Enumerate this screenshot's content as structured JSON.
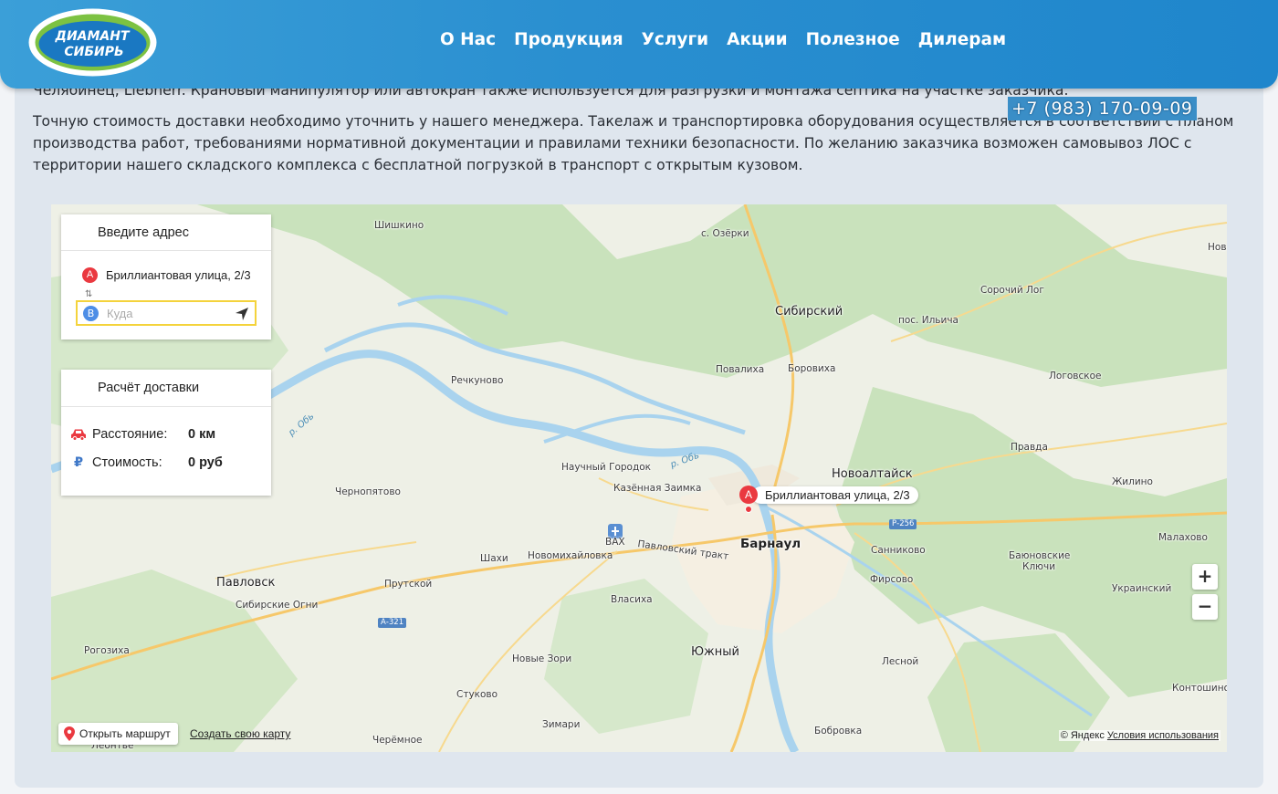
{
  "header": {
    "logo_line1": "ДИАМАНТ",
    "logo_line2": "СИБИРЬ",
    "nav": [
      "О Нас",
      "Продукция",
      "Услуги",
      "Акции",
      "Полезное",
      "Дилерам"
    ],
    "phone": "+7 (983) 170-09-09"
  },
  "content": {
    "para1": "Челябинец, Liebherr. Крановый манипулятор или автокран также используется для разгрузки и монтажа септика на участке заказчика.",
    "para2": "Точную стоимость доставки необходимо уточнить у нашего менеджера. Такелаж и транспортировка оборудования осуществляется в соответствии с планом производства работ, требованиями нормативной документации и правилами техники безопасности. По желанию заказчика возможен самовывоз ЛОС с территории нашего складского комплекса с бесплатной погрузкой в транспорт с открытым кузовом."
  },
  "address_panel": {
    "title": "Введите адрес",
    "point_a_letter": "A",
    "point_a_value": "Бриллиантовая улица, 2/3",
    "swap_icon": "⇅",
    "point_b_letter": "B",
    "point_b_placeholder": "Куда"
  },
  "calc_panel": {
    "title": "Расчёт доставки",
    "distance_label": "Расстояние:",
    "distance_value": "0 км",
    "cost_label": "Стоимость:",
    "cost_value": "0 руб",
    "cost_icon": "₽"
  },
  "map": {
    "placemark_letter": "A",
    "placemark_label": "Бриллиантовая улица, 2/3",
    "zoom_in": "+",
    "zoom_out": "−",
    "open_route": "Открыть маршрут",
    "create_map": "Создать свою карту",
    "copyright": "© Яндекс",
    "terms": "Условия использования",
    "places": {
      "shishkino": "Шишкино",
      "ozerki": "с. Озёрки",
      "nov": "Нов",
      "sorochiy_log": "Сорочий Лог",
      "sibirskiy": "Сибирский",
      "ilyicha": "пос. Ильича",
      "rechkunovo": "Речкуново",
      "povalikha": "Повалиха",
      "borovikha": "Боровиха",
      "logovskoe": "Логовское",
      "pravda": "Правда",
      "nauchny": "Научный Городок",
      "novoaltaysk": "Новоалтайск",
      "zhilino": "Жилино",
      "chernopyatovo": "Чернопятово",
      "kazennaya": "Казённая Заимка",
      "vax": "ВАХ",
      "barnaul": "Барнаул",
      "sannikovo": "Санниково",
      "malakhovo": "Малахово",
      "shakhi": "Шахи",
      "novomikh": "Новомихайловка",
      "pavlovsky_trakt": "Павловский тракт",
      "bayunovskie": "Баюновские",
      "klyuchi": "Ключи",
      "firsovo": "Фирсово",
      "pavlovsk": "Павловск",
      "prutskoy": "Прутской",
      "sibirskie_ogni": "Сибирские Огни",
      "vlasikha": "Власиха",
      "ukrainskiy": "Украинский",
      "rogozikha": "Рогозиха",
      "yuzhny": "Южный",
      "novye_zori": "Новые Зори",
      "lesnoy": "Лесной",
      "stukovo": "Стуково",
      "kontoshino": "Контошино",
      "zimari": "Зимари",
      "bobrovka": "Бобровка",
      "cheremnoe": "Черёмное",
      "leozhye": "Леонтье",
      "river_ob1": "р. Обь",
      "river_ob2": "р. Обь",
      "road_a321": "А-321",
      "road_r256": "Р-256"
    }
  },
  "colors": {
    "header_gradient_start": "#3b9fd8",
    "header_gradient_end": "#1f86cc",
    "point_a": "#ea3940",
    "point_b": "#4e8ee6",
    "input_border": "#f4d33c",
    "river": "#a9d3ee",
    "forest": "#c9e2bc"
  }
}
